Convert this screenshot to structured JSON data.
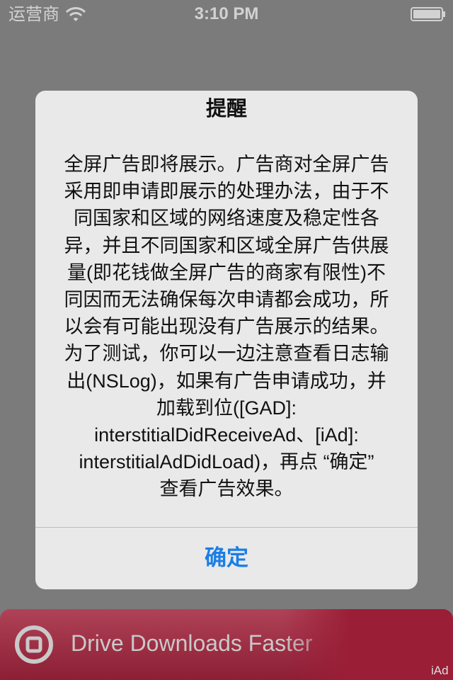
{
  "status_bar": {
    "carrier": "运营商",
    "time": "3:10 PM"
  },
  "alert": {
    "title": "提醒",
    "message": "全屏广告即将展示。广告商对全屏广告\n采用即申请即展示的处理办法，由于不\n同国家和区域的网络速度及稳定性各\n异，并且不同国家和区域全屏广告供展\n量(即花钱做全屏广告的商家有限性)不\n同因而无法确保每次申请都会成功，所\n以会有可能出现没有广告展示的结果。\n为了测试，你可以一边注意查看日志输\n出(NSLog)，如果有广告申请成功，并\n加载到位([GAD]:\ninterstitialDidReceiveAd、[iAd]:\ninterstitialAdDidLoad)，再点 “确定”\n查看广告效果。",
    "ok_label": "确定"
  },
  "ad_banner": {
    "text": "Drive Downloads Faster",
    "badge": "iAd",
    "icon": "target-icon"
  },
  "icons": {
    "wifi": "wifi-icon",
    "battery": "battery-icon"
  },
  "colors": {
    "background": "#7b7b7b",
    "alert_background": "#e9e9e9",
    "button_text": "#1a7ee6",
    "banner": "#9a1e36"
  }
}
